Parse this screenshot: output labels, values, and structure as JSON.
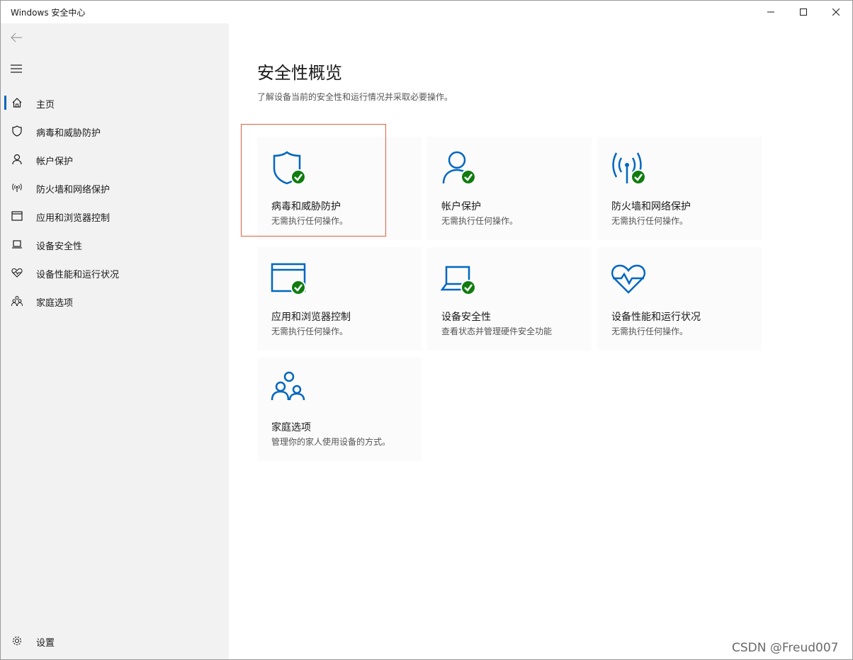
{
  "window": {
    "title": "Windows 安全中心"
  },
  "sidebar": {
    "items": [
      {
        "label": "主页",
        "icon": "home-icon"
      },
      {
        "label": "病毒和威胁防护",
        "icon": "shield-icon"
      },
      {
        "label": "帐户保护",
        "icon": "person-icon"
      },
      {
        "label": "防火墙和网络保护",
        "icon": "wifi-antenna-icon"
      },
      {
        "label": "应用和浏览器控制",
        "icon": "browser-window-icon"
      },
      {
        "label": "设备安全性",
        "icon": "laptop-icon"
      },
      {
        "label": "设备性能和运行状况",
        "icon": "heart-pulse-icon"
      },
      {
        "label": "家庭选项",
        "icon": "family-icon"
      }
    ],
    "settings_label": "设置"
  },
  "main": {
    "title": "安全性概览",
    "subtitle": "了解设备当前的安全性和运行情况并采取必要操作。",
    "tiles": [
      {
        "title": "病毒和威胁防护",
        "desc": "无需执行任何操作。",
        "icon": "shield-check-icon"
      },
      {
        "title": "帐户保护",
        "desc": "无需执行任何操作。",
        "icon": "person-check-icon"
      },
      {
        "title": "防火墙和网络保护",
        "desc": "无需执行任何操作。",
        "icon": "antenna-check-icon"
      },
      {
        "title": "应用和浏览器控制",
        "desc": "无需执行任何操作。",
        "icon": "browser-check-icon"
      },
      {
        "title": "设备安全性",
        "desc": "查看状态并管理硬件安全功能",
        "icon": "laptop-check-icon"
      },
      {
        "title": "设备性能和运行状况",
        "desc": "无需执行任何操作。",
        "icon": "heart-pulse-icon"
      },
      {
        "title": "家庭选项",
        "desc": "管理你的家人使用设备的方式。",
        "icon": "family-icon"
      }
    ]
  },
  "watermark": "CSDN @Freud007",
  "colors": {
    "accent": "#0067c0",
    "ok": "#107c10",
    "highlight": "#e06040"
  }
}
